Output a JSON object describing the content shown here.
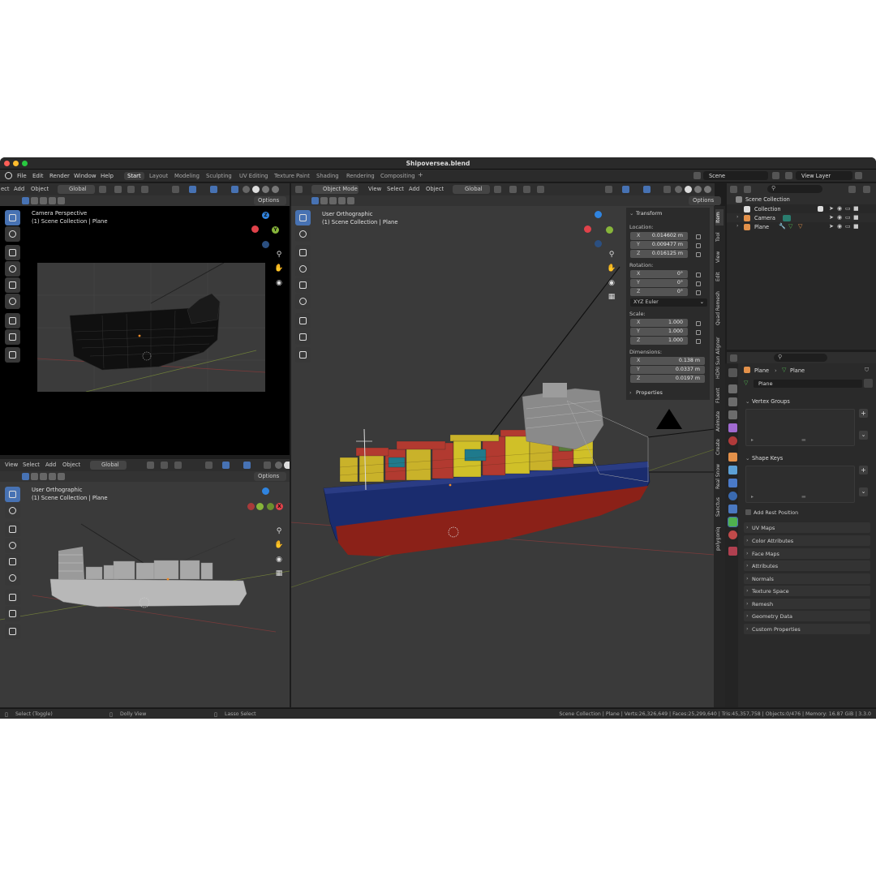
{
  "window": {
    "title": "Shipoversea.blend"
  },
  "menu": [
    "File",
    "Edit",
    "Render",
    "Window",
    "Help"
  ],
  "workspaces": [
    "Start",
    "Layout",
    "Modeling",
    "Sculpting",
    "UV Editing",
    "Texture Paint",
    "Shading",
    "Rendering",
    "Compositing",
    "+"
  ],
  "scene": {
    "name": "Scene",
    "view_layer": "View Layer"
  },
  "viewport_tl": {
    "header": {
      "mode_cut": "ect",
      "add": "Add",
      "object": "Object",
      "orientation": "Global",
      "options": "Options"
    },
    "title": "Camera Perspective",
    "subtitle": "(1) Scene Collection | Plane"
  },
  "viewport_bl": {
    "header": {
      "view": "View",
      "select": "Select",
      "add": "Add",
      "object": "Object",
      "orientation": "Global",
      "options": "Options"
    },
    "title": "User Orthographic",
    "subtitle": "(1) Scene Collection | Plane"
  },
  "viewport_main": {
    "header": {
      "mode": "Object Mode",
      "view": "View",
      "select": "Select",
      "add": "Add",
      "object": "Object",
      "orientation": "Global",
      "options": "Options"
    },
    "title": "User Orthographic",
    "subtitle": "(1) Scene Collection | Plane"
  },
  "gizmo": {
    "x": "X",
    "y": "Y",
    "z": "Z"
  },
  "transform": {
    "header": "Transform",
    "location_label": "Location:",
    "location": [
      {
        "k": "X",
        "v": "0.014602 m"
      },
      {
        "k": "Y",
        "v": "0.009477 m"
      },
      {
        "k": "Z",
        "v": "0.016125 m"
      }
    ],
    "rotation_label": "Rotation:",
    "rotation": [
      {
        "k": "X",
        "v": "0°"
      },
      {
        "k": "Y",
        "v": "0°"
      },
      {
        "k": "Z",
        "v": "0°"
      }
    ],
    "rotation_mode": "XYZ Euler",
    "scale_label": "Scale:",
    "scale": [
      {
        "k": "X",
        "v": "1.000"
      },
      {
        "k": "Y",
        "v": "1.000"
      },
      {
        "k": "Z",
        "v": "1.000"
      }
    ],
    "dimensions_label": "Dimensions:",
    "dimensions": [
      {
        "k": "X",
        "v": "0.138 m"
      },
      {
        "k": "Y",
        "v": "0.0337 m"
      },
      {
        "k": "Z",
        "v": "0.0197 m"
      }
    ],
    "properties": "Properties"
  },
  "sidebar_tabs": [
    "Item",
    "Tool",
    "View",
    "Edit",
    "Quad Remesh",
    "HDRI Sun Aligner",
    "Fluent",
    "Animate",
    "Create",
    "Real Snow",
    "Sanctus",
    "polygoniq"
  ],
  "outliner": {
    "root": "Scene Collection",
    "items": [
      "Collection",
      "Camera",
      "Plane"
    ]
  },
  "properties": {
    "breadcrumb": [
      "Plane",
      "Plane"
    ],
    "datablock": "Plane",
    "vertex_groups": "Vertex Groups",
    "shape_keys": "Shape Keys",
    "add_rest_position": "Add Rest Position",
    "sections": [
      "UV Maps",
      "Color Attributes",
      "Face Maps",
      "Attributes",
      "Normals",
      "Texture Space",
      "Remesh",
      "Geometry Data",
      "Custom Properties"
    ]
  },
  "status": {
    "left": "Select (Toggle)",
    "mid": "Dolly View",
    "right": "Lasso Select",
    "stats": "Scene Collection | Plane | Verts:26,326,649 | Faces:25,299,640 | Tris:45,357,758 | Objects:0/476 | Memory: 16.87 GiB | 3.3.0"
  },
  "colors": {
    "accent": "#4772b3",
    "x_axis": "#e0424a",
    "y_axis": "#87b53a",
    "z_axis": "#2f84e0",
    "hull_blue": "#1a2c6e",
    "hull_red": "#8b2118"
  }
}
